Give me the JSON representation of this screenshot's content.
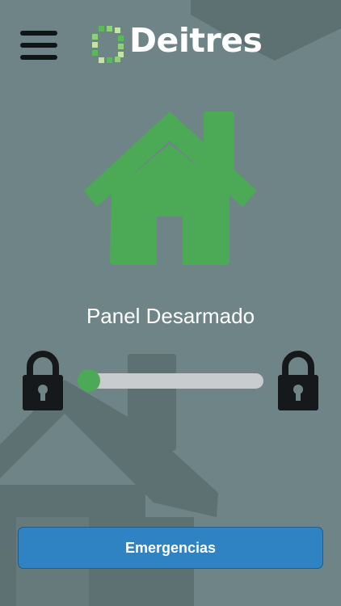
{
  "header": {
    "brand_name": "Deitres",
    "menu_icon": "hamburger-menu-icon",
    "logo_icon": "deitres-logo-icon"
  },
  "main": {
    "status_icon": "house-icon",
    "status_label": "Panel Desarmado",
    "arm_slider": {
      "value": 0,
      "left_icon": "lock-icon",
      "right_icon": "lock-icon"
    }
  },
  "footer": {
    "emergency_label": "Emergencias"
  },
  "colors": {
    "background": "#6e8486",
    "accent_green": "#4caa57",
    "button_blue": "#2f83c3",
    "lock_dark": "#15191b"
  }
}
